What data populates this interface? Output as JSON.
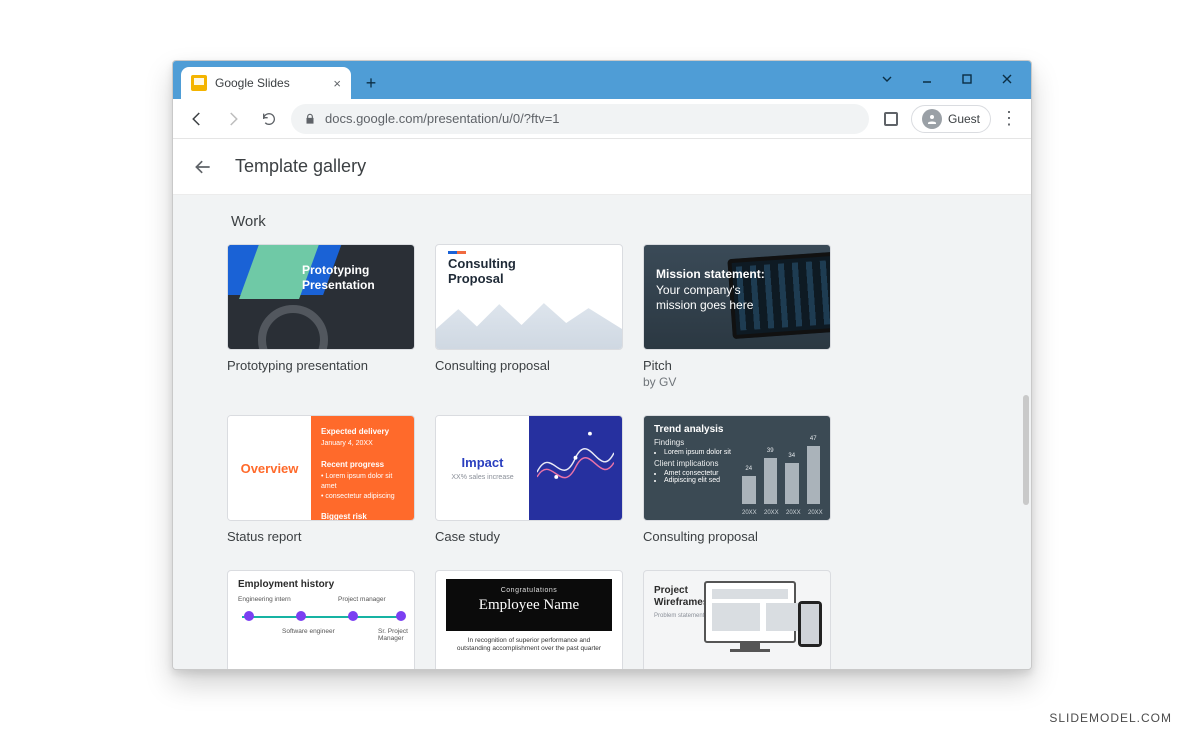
{
  "watermark": "SLIDEMODEL.COM",
  "browser": {
    "tab_title": "Google Slides",
    "url": "docs.google.com/presentation/u/0/?ftv=1",
    "guest_label": "Guest"
  },
  "page": {
    "title": "Template gallery",
    "section": "Work"
  },
  "templates": [
    {
      "title": "Prototyping presentation",
      "subtitle": "",
      "thumb": {
        "kind": "proto",
        "line1": "Prototyping",
        "line2": "Presentation"
      }
    },
    {
      "title": "Consulting proposal",
      "subtitle": "",
      "thumb": {
        "kind": "consult",
        "line1": "Consulting",
        "line2": "Proposal"
      }
    },
    {
      "title": "Pitch",
      "subtitle": "by GV",
      "thumb": {
        "kind": "pitch",
        "bold": "Mission statement:",
        "l2": "Your company's",
        "l3": "mission goes here"
      }
    },
    {
      "title": "Status report",
      "subtitle": "",
      "thumb": {
        "kind": "status",
        "left": "Overview",
        "r_head": "Expected delivery",
        "r_sub": "Recent progress",
        "r_sub2": "Biggest risk"
      }
    },
    {
      "title": "Case study",
      "subtitle": "",
      "thumb": {
        "kind": "case",
        "big": "Impact",
        "sub": "XX% sales increase"
      }
    },
    {
      "title": "Consulting proposal",
      "subtitle": "",
      "thumb": {
        "kind": "trend",
        "title": "Trend analysis",
        "sub": "Findings",
        "sub2": "Client implications",
        "bars": [
          22,
          38,
          34,
          46
        ],
        "labels": [
          "20XX",
          "20XX",
          "20XX",
          "20XX"
        ],
        "vals": [
          "24",
          "39",
          "34",
          "47"
        ]
      }
    },
    {
      "title": "",
      "subtitle": "",
      "thumb": {
        "kind": "employ",
        "title": "Employment history",
        "p1": "Engineering intern",
        "p2": "Project manager",
        "p3": "Software engineer",
        "p4": "Sr. Project Manager"
      }
    },
    {
      "title": "",
      "subtitle": "",
      "thumb": {
        "kind": "award",
        "top": "Congratulations",
        "name": "Employee Name",
        "cap": "In recognition of superior performance and outstanding accomplishment over the past quarter"
      }
    },
    {
      "title": "",
      "subtitle": "",
      "thumb": {
        "kind": "wire",
        "l1": "Project",
        "l2": "Wireframes"
      }
    }
  ]
}
